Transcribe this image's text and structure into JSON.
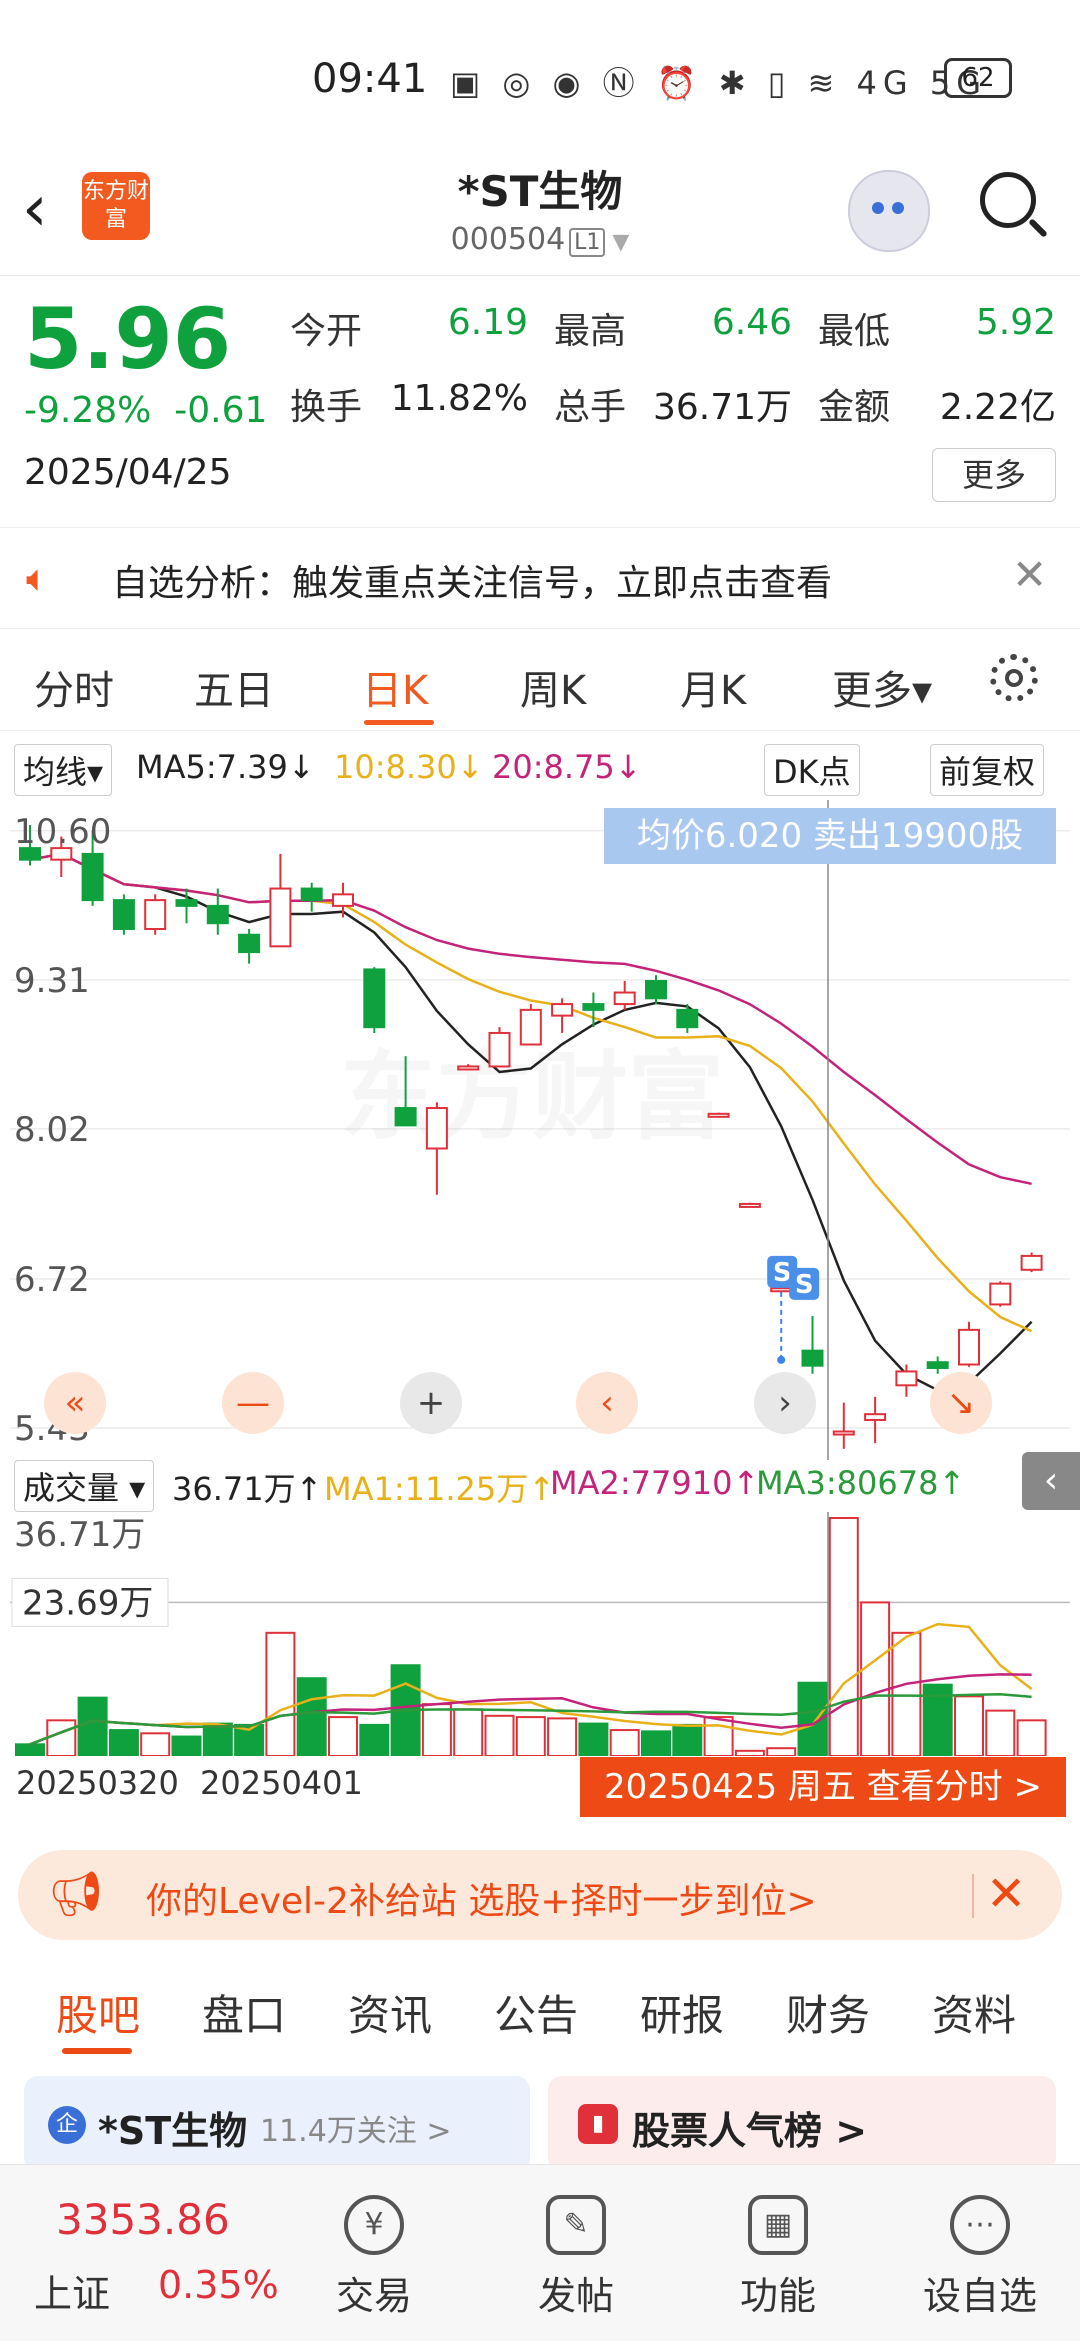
{
  "status_bar": {
    "time": "09:41",
    "icons": "▣ ◎ ◉ Ⓝ ⏰ ✱ ▯ ≋ 4G 5G",
    "battery": "62"
  },
  "header": {
    "logo_text": "东方财富",
    "stock_name": "*ST生物",
    "stock_code": "000504",
    "code_badge": "L1"
  },
  "quote": {
    "price": "5.96",
    "change_pct": "-9.28%",
    "change": "-0.61",
    "date": "2025/04/25",
    "open_label": "今开",
    "open": "6.19",
    "high_label": "最高",
    "high": "6.46",
    "low_label": "最低",
    "low": "5.92",
    "turnover_label": "换手",
    "turnover": "11.82%",
    "volume_label": "总手",
    "volume": "36.71万",
    "amount_label": "金额",
    "amount": "2.22亿",
    "more_label": "更多"
  },
  "analysis": {
    "text": "自选分析：触发重点关注信号，立即点击查看"
  },
  "period_tabs": [
    "分时",
    "五日",
    "日K",
    "周K",
    "月K",
    "更多▾"
  ],
  "active_period": "日K",
  "ma_bar": {
    "type_label": "均线▾",
    "ma5": "MA5:7.39↓",
    "ma10": "10:8.30↓",
    "ma20": "20:8.75↓",
    "dk_label": "DK点",
    "adjust_label": "前复权"
  },
  "chart_overlay": {
    "avg_price": "均价6.020  卖出19900股",
    "sell_marker": "S"
  },
  "volume_bar": {
    "label": "成交量 ▾",
    "vol": "36.71万↑",
    "ma1": "MA1:11.25万↑",
    "ma2": "MA2:77910↑",
    "ma3": "MA3:80678↑"
  },
  "date_axis": [
    "20250320",
    "20250401"
  ],
  "view_timeshare": "20250425 周五 查看分时 >",
  "level2_banner": "你的Level-2补给站 选股+择时一步到位>",
  "bottom_tabs": [
    "股吧",
    "盘口",
    "资讯",
    "公告",
    "研报",
    "财务",
    "资料"
  ],
  "cards": {
    "stock": "*ST生物",
    "followers": "11.4万关注 >",
    "popularity": "股票人气榜 >",
    "badge": "企"
  },
  "nav": {
    "index_value": "3353.86",
    "index_name": "上证",
    "index_pct": "0.35%",
    "items": [
      {
        "label": "交易",
        "icon": "¥"
      },
      {
        "label": "发帖",
        "icon": "✎"
      },
      {
        "label": "功能",
        "icon": "▦"
      },
      {
        "label": "设自选",
        "icon": "⋯"
      }
    ]
  },
  "chart_data": {
    "type": "candlestick",
    "price_axis_ticks": [
      10.6,
      9.31,
      8.02,
      6.72,
      5.43
    ],
    "volume_axis_ticks": [
      "36.71万",
      "23.69万"
    ],
    "colors": {
      "up": "#e0303a",
      "down": "#10a13f",
      "ma5": "#222222",
      "ma10": "#e8b019",
      "ma20": "#c4237a",
      "vol_ma1": "#e8b019",
      "vol_ma2": "#c4237a",
      "vol_ma3": "#2a9a3a"
    },
    "candles": [
      {
        "o": 10.45,
        "h": 10.65,
        "l": 10.3,
        "c": 10.35
      },
      {
        "o": 10.35,
        "h": 10.55,
        "l": 10.2,
        "c": 10.45
      },
      {
        "o": 10.4,
        "h": 10.6,
        "l": 9.95,
        "c": 10.0
      },
      {
        "o": 10.0,
        "h": 10.05,
        "l": 9.7,
        "c": 9.75
      },
      {
        "o": 9.75,
        "h": 10.05,
        "l": 9.7,
        "c": 10.0
      },
      {
        "o": 10.0,
        "h": 10.1,
        "l": 9.8,
        "c": 9.95
      },
      {
        "o": 9.95,
        "h": 10.1,
        "l": 9.7,
        "c": 9.8
      },
      {
        "o": 9.7,
        "h": 9.75,
        "l": 9.45,
        "c": 9.55
      },
      {
        "o": 9.6,
        "h": 10.4,
        "l": 9.6,
        "c": 10.1
      },
      {
        "o": 10.1,
        "h": 10.15,
        "l": 9.9,
        "c": 10.0
      },
      {
        "o": 9.95,
        "h": 10.15,
        "l": 9.85,
        "c": 10.05
      },
      {
        "o": 9.4,
        "h": 9.42,
        "l": 8.85,
        "c": 8.9
      },
      {
        "o": 8.2,
        "h": 8.65,
        "l": 8.05,
        "c": 8.05
      },
      {
        "o": 7.85,
        "h": 8.25,
        "l": 7.45,
        "c": 8.2
      },
      {
        "o": 8.55,
        "h": 8.58,
        "l": 8.53,
        "c": 8.56
      },
      {
        "o": 8.56,
        "h": 8.9,
        "l": 8.56,
        "c": 8.85
      },
      {
        "o": 8.75,
        "h": 9.1,
        "l": 8.75,
        "c": 9.05
      },
      {
        "o": 9.0,
        "h": 9.15,
        "l": 8.85,
        "c": 9.1
      },
      {
        "o": 9.1,
        "h": 9.2,
        "l": 8.9,
        "c": 9.05
      },
      {
        "o": 9.1,
        "h": 9.3,
        "l": 9.05,
        "c": 9.2
      },
      {
        "o": 9.3,
        "h": 9.35,
        "l": 9.1,
        "c": 9.15
      },
      {
        "o": 9.05,
        "h": 9.1,
        "l": 8.85,
        "c": 8.9
      },
      {
        "o": 8.15,
        "h": 8.16,
        "l": 8.14,
        "c": 8.15
      },
      {
        "o": 7.37,
        "h": 7.38,
        "l": 7.36,
        "c": 7.37
      },
      {
        "o": 6.64,
        "h": 6.65,
        "l": 6.63,
        "c": 6.64
      },
      {
        "o": 6.1,
        "h": 6.4,
        "l": 5.9,
        "c": 5.97
      },
      {
        "o": 5.4,
        "h": 5.65,
        "l": 5.25,
        "c": 5.4
      },
      {
        "o": 5.5,
        "h": 5.7,
        "l": 5.3,
        "c": 5.55
      },
      {
        "o": 5.8,
        "h": 5.98,
        "l": 5.7,
        "c": 5.92
      },
      {
        "o": 6.0,
        "h": 6.05,
        "l": 5.9,
        "c": 5.95
      },
      {
        "o": 5.98,
        "h": 6.35,
        "l": 5.96,
        "c": 6.28
      },
      {
        "o": 6.5,
        "h": 6.7,
        "l": 6.48,
        "c": 6.68
      },
      {
        "o": 6.8,
        "h": 6.95,
        "l": 6.78,
        "c": 6.92
      }
    ],
    "volume": [
      18000,
      55000,
      90000,
      40000,
      35000,
      30000,
      50000,
      48000,
      190000,
      120000,
      60000,
      48000,
      140000,
      80000,
      72000,
      62000,
      60000,
      58000,
      50000,
      40000,
      38000,
      48000,
      60000,
      8000,
      12000,
      113000,
      367100,
      236900,
      190000,
      110000,
      92000,
      70000,
      55000
    ],
    "sell_marker": {
      "candle_index": 24,
      "label": "S",
      "price": 6.02
    }
  }
}
